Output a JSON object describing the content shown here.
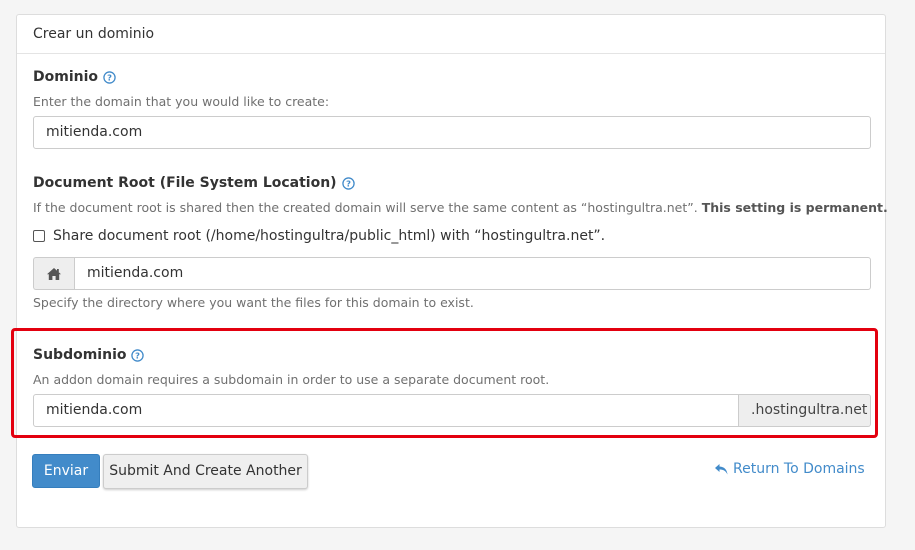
{
  "panel": {
    "title": "Crear un dominio"
  },
  "domain": {
    "label": "Dominio",
    "help": "Enter the domain that you would like to create:",
    "value": "mitienda.com"
  },
  "document_root": {
    "label": "Document Root (File System Location)",
    "help_prefix": "If the document root is shared then the created domain will serve the same content as “hostingultra.net”.",
    "help_bold": "This setting is permanent.",
    "share_checkbox_label": "Share document root (/home/hostingultra/public_html) with “hostingultra.net”.",
    "share_checked": false,
    "value": "mitienda.com",
    "hint": "Specify the directory where you want the files for this domain to exist."
  },
  "subdomain": {
    "label": "Subdominio",
    "help": "An addon domain requires a subdomain in order to use a separate document root.",
    "value": "mitienda.com",
    "suffix": ".hostingultra.net"
  },
  "actions": {
    "submit_label": "Enviar",
    "submit_another_label": "Submit And Create Another",
    "return_label": "Return To Domains"
  },
  "icons": {
    "help": "help-circle-icon",
    "home": "home-icon",
    "return": "undo-arrow-icon"
  },
  "colors": {
    "primary": "#428bca",
    "highlight": "#e3000f"
  }
}
